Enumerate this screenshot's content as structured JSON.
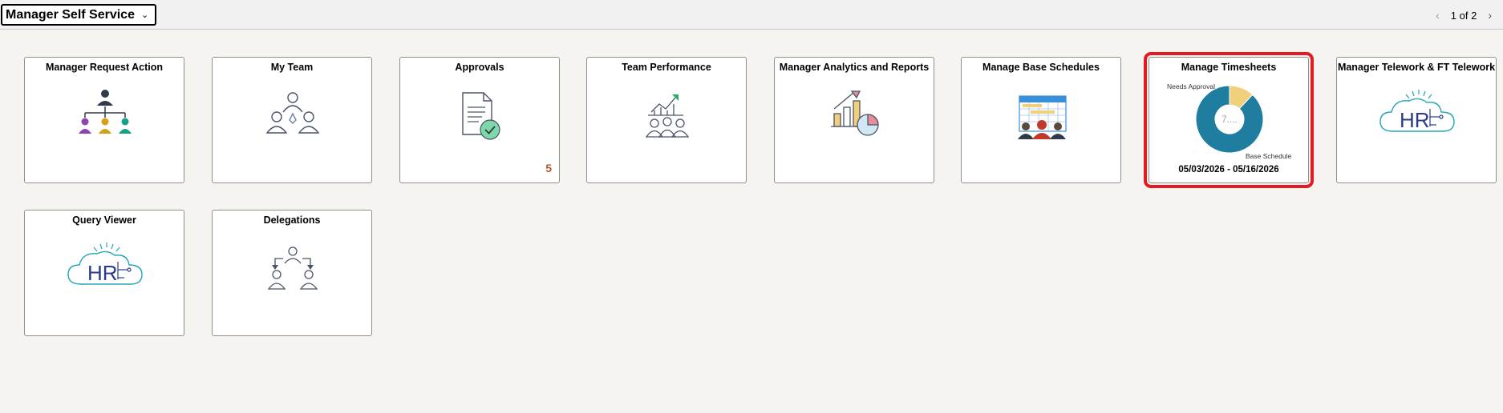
{
  "header": {
    "homepage_title": "Manager Self Service",
    "pager_text": "1 of 2"
  },
  "tiles": [
    {
      "title": "Manager Request Action"
    },
    {
      "title": "My Team"
    },
    {
      "title": "Approvals",
      "badge": "5"
    },
    {
      "title": "Team Performance"
    },
    {
      "title": "Manager Analytics and Reports"
    },
    {
      "title": "Manage Base Schedules"
    },
    {
      "title": "Manage Timesheets",
      "date_range": "05/03/2026 - 05/16/2026"
    },
    {
      "title": "Manager Telework & FT Telework"
    },
    {
      "title": "Query Viewer"
    },
    {
      "title": "Delegations"
    }
  ],
  "chart_data": {
    "type": "pie",
    "categories": [
      "Needs Approval",
      "Base Schedule"
    ],
    "values": [
      12,
      88
    ],
    "center_label": "7....",
    "colors": [
      "#f2cf7a",
      "#1f7ea0"
    ]
  },
  "colors": {
    "selected_outline": "#e31b23",
    "badge": "#b5592b"
  }
}
